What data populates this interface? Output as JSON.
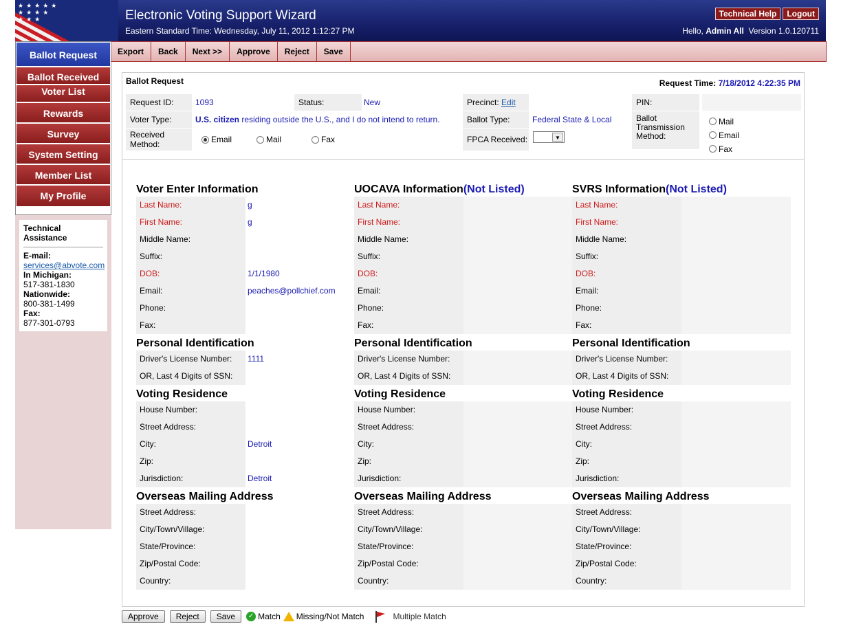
{
  "header": {
    "title": "Electronic Voting Support Wizard",
    "time": "Eastern Standard Time: Wednesday, July 11, 2012 1:12:27 PM",
    "tech_help": "Technical Help",
    "logout": "Logout",
    "hello": "Hello,",
    "user": "Admin All",
    "version": "Version 1.0.120711"
  },
  "toolbar": [
    "Export",
    "Back",
    "Next >>",
    "Approve",
    "Reject",
    "Save"
  ],
  "sidebar": {
    "items": [
      "Ballot Request",
      "Ballot Received",
      "Voter List",
      "Rewards",
      "Survey",
      "System Setting",
      "Member List",
      "My Profile"
    ],
    "assist": {
      "title": "Technical Assistance",
      "email_label": "E-mail:",
      "email": "services@abvote.com",
      "mi_label": "In Michigan:",
      "mi_phone": "517-381-1830",
      "nw_label": "Nationwide:",
      "nw_phone": "800-381-1499",
      "fax_label": "Fax:",
      "fax": "877-301-0793"
    }
  },
  "panel": {
    "title": "Ballot Request",
    "req_time_label": "Request Time:",
    "req_time": "7/18/2012 4:22:35 PM",
    "request_id_label": "Request ID:",
    "request_id": "1093",
    "status_label": "Status:",
    "status": "New",
    "precinct_label": "Precinct:",
    "precinct_link": "Edit",
    "pin_label": "PIN:",
    "voter_type_label": "Voter Type:",
    "voter_type_bold": "U.S. citizen",
    "voter_type_rest": "residing outside the U.S., and I do not intend to return.",
    "ballot_type_label": "Ballot Type:",
    "ballot_type": "Federal State & Local",
    "btm_label": "Ballot Transmission Method:",
    "btm_options": [
      "Mail",
      "Email",
      "Fax"
    ],
    "received_method_label": "Received Method:",
    "received_options": [
      "Email",
      "Mail",
      "Fax"
    ],
    "fpca_label": "FPCA Received:"
  },
  "columns": [
    {
      "title": "Voter Enter Information",
      "title_suffix": "",
      "voter": [
        {
          "label": "Last Name:",
          "value": "g",
          "required": true
        },
        {
          "label": "First Name:",
          "value": "g",
          "required": true
        },
        {
          "label": "Middle Name:",
          "value": "",
          "required": false
        },
        {
          "label": "Suffix:",
          "value": "",
          "required": false
        },
        {
          "label": "DOB:",
          "value": "1/1/1980",
          "required": true
        },
        {
          "label": "Email:",
          "value": "peaches@pollchief.com",
          "required": false
        },
        {
          "label": "Phone:",
          "value": "",
          "required": false
        },
        {
          "label": "Fax:",
          "value": "",
          "required": false
        }
      ],
      "id": [
        {
          "label": "Driver's License Number:",
          "value": "1111"
        },
        {
          "label": "OR, Last 4 Digits of SSN:",
          "value": ""
        }
      ],
      "residence": [
        {
          "label": "House Number:",
          "value": ""
        },
        {
          "label": "Street Address:",
          "value": ""
        },
        {
          "label": "City:",
          "value": "Detroit"
        },
        {
          "label": "Zip:",
          "value": ""
        },
        {
          "label": "Jurisdiction:",
          "value": "Detroit"
        }
      ],
      "overseas": [
        {
          "label": "Street Address:",
          "value": ""
        },
        {
          "label": "City/Town/Village:",
          "value": ""
        },
        {
          "label": "State/Province:",
          "value": ""
        },
        {
          "label": "Zip/Postal Code:",
          "value": ""
        },
        {
          "label": "Country:",
          "value": ""
        }
      ]
    },
    {
      "title": "UOCAVA Information",
      "title_suffix": "(Not Listed)",
      "voter": [
        {
          "label": "Last Name:",
          "value": "",
          "required": true
        },
        {
          "label": "First Name:",
          "value": "",
          "required": true
        },
        {
          "label": "Middle Name:",
          "value": "",
          "required": false
        },
        {
          "label": "Suffix:",
          "value": "",
          "required": false
        },
        {
          "label": "DOB:",
          "value": "",
          "required": true
        },
        {
          "label": "Email:",
          "value": "",
          "required": false
        },
        {
          "label": "Phone:",
          "value": "",
          "required": false
        },
        {
          "label": "Fax:",
          "value": "",
          "required": false
        }
      ],
      "id": [
        {
          "label": "Driver's License Number:",
          "value": ""
        },
        {
          "label": "OR, Last 4 Digits of SSN:",
          "value": ""
        }
      ],
      "residence": [
        {
          "label": "House Number:",
          "value": ""
        },
        {
          "label": "Street Address:",
          "value": ""
        },
        {
          "label": "City:",
          "value": ""
        },
        {
          "label": "Zip:",
          "value": ""
        },
        {
          "label": "Jurisdiction:",
          "value": ""
        }
      ],
      "overseas": [
        {
          "label": "Street Address:",
          "value": ""
        },
        {
          "label": "City/Town/Village:",
          "value": ""
        },
        {
          "label": "State/Province:",
          "value": ""
        },
        {
          "label": "Zip/Postal Code:",
          "value": ""
        },
        {
          "label": "Country:",
          "value": ""
        }
      ]
    },
    {
      "title": "SVRS Information",
      "title_suffix": "(Not Listed)",
      "voter": [
        {
          "label": "Last Name:",
          "value": "",
          "required": true
        },
        {
          "label": "First Name:",
          "value": "",
          "required": true
        },
        {
          "label": "Middle Name:",
          "value": "",
          "required": false
        },
        {
          "label": "Suffix:",
          "value": "",
          "required": false
        },
        {
          "label": "DOB:",
          "value": "",
          "required": true
        },
        {
          "label": "Email:",
          "value": "",
          "required": false
        },
        {
          "label": "Phone:",
          "value": "",
          "required": false
        },
        {
          "label": "Fax:",
          "value": "",
          "required": false
        }
      ],
      "id": [
        {
          "label": "Driver's License Number:",
          "value": ""
        },
        {
          "label": "OR, Last 4 Digits of SSN:",
          "value": ""
        }
      ],
      "residence": [
        {
          "label": "House Number:",
          "value": ""
        },
        {
          "label": "Street Address:",
          "value": ""
        },
        {
          "label": "City:",
          "value": ""
        },
        {
          "label": "Zip:",
          "value": ""
        },
        {
          "label": "Jurisdiction:",
          "value": ""
        }
      ],
      "overseas": [
        {
          "label": "Street Address:",
          "value": ""
        },
        {
          "label": "City/Town/Village:",
          "value": ""
        },
        {
          "label": "State/Province:",
          "value": ""
        },
        {
          "label": "Zip/Postal Code:",
          "value": ""
        },
        {
          "label": "Country:",
          "value": ""
        }
      ]
    }
  ],
  "section_titles": {
    "personal_id": "Personal Identification",
    "residence": "Voting Residence",
    "overseas": "Overseas Mailing Address"
  },
  "bottom": {
    "approve": "Approve",
    "reject": "Reject",
    "save": "Save",
    "legend_match": "Match",
    "legend_missing": "Missing/Not Match",
    "legend_multiple": "Multiple Match"
  },
  "colors": {
    "header_blue": "#17206a",
    "nav_red": "#8a1e1e",
    "nav_active_blue": "#2237a0",
    "link_blue": "#1a1ab3",
    "required_red": "#cc1a1a"
  }
}
